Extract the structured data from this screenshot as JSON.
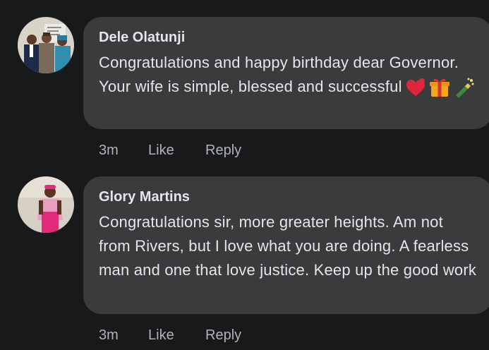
{
  "comments": [
    {
      "author": "Dele Olatunji",
      "text": "Congratulations and happy birthday dear Governor. Your wife is simple, blessed  and successful",
      "emojis": [
        "heart-icon",
        "gift-icon",
        "champagne-icon"
      ],
      "time": "3m",
      "like_label": "Like",
      "reply_label": "Reply"
    },
    {
      "author": "Glory Martins",
      "text": "Congratulations sir, more greater heights. Am not from Rivers, but I love what you are doing. A fearless man and one that love justice. Keep up the good work",
      "time": "3m",
      "like_label": "Like",
      "reply_label": "Reply"
    }
  ],
  "colors": {
    "background": "#18191a",
    "bubble": "#3a3b3c",
    "text": "#e4e6eb",
    "secondary_text": "#b0b3b8"
  }
}
